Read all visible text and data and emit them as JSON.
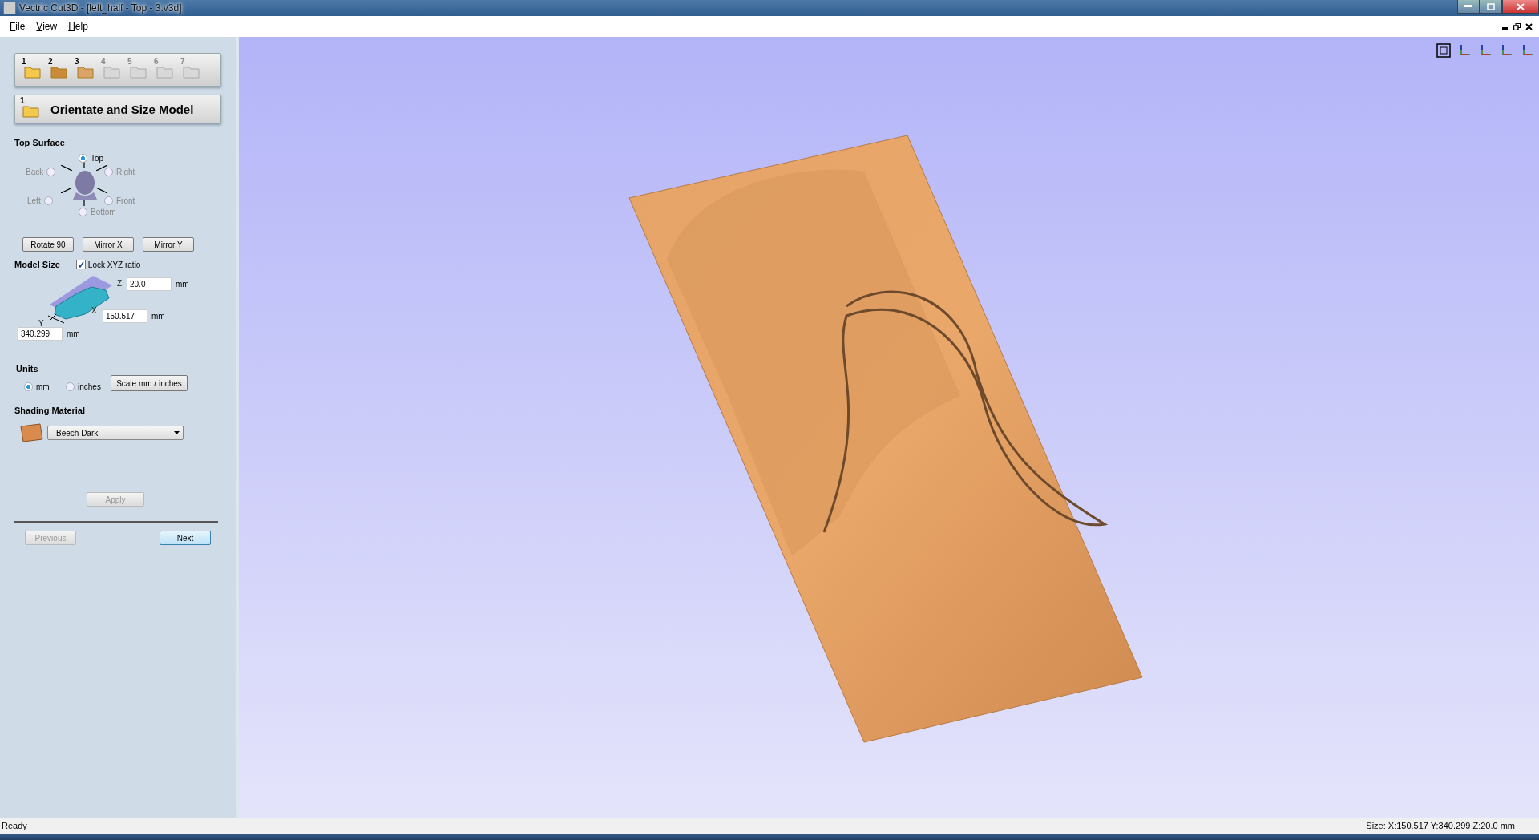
{
  "window": {
    "title": "Vectric Cut3D - [left_half - Top - 3.v3d]"
  },
  "menu": [
    {
      "label": "File"
    },
    {
      "label": "View"
    },
    {
      "label": "Help"
    }
  ],
  "wizard_steps": [
    {
      "label": "1",
      "enabled": true
    },
    {
      "label": "2",
      "enabled": true
    },
    {
      "label": "3",
      "enabled": true
    },
    {
      "label": "4",
      "enabled": false
    },
    {
      "label": "5",
      "enabled": false
    },
    {
      "label": "6",
      "enabled": false
    },
    {
      "label": "7",
      "enabled": false
    }
  ],
  "heading": {
    "step": "1",
    "title": "Orientate and Size Model"
  },
  "top_surface": {
    "label": "Top Surface",
    "options": [
      {
        "label": "Top",
        "selected": true
      },
      {
        "label": "Back",
        "selected": false
      },
      {
        "label": "Right",
        "selected": false
      },
      {
        "label": "Left",
        "selected": false
      },
      {
        "label": "Front",
        "selected": false
      },
      {
        "label": "Bottom",
        "selected": false
      }
    ],
    "buttons": [
      {
        "label": "Rotate 90"
      },
      {
        "label": "Mirror X"
      },
      {
        "label": "Mirror Y"
      }
    ]
  },
  "model_size": {
    "label": "Model Size",
    "lock": {
      "label": "Lock XYZ ratio",
      "checked": true
    },
    "axes": [
      "Z",
      "X",
      "Y"
    ],
    "fields": [
      {
        "value": "20.0",
        "unit": "mm"
      },
      {
        "value": "150.517",
        "unit": "mm"
      },
      {
        "value": "340.299",
        "unit": "mm"
      }
    ]
  },
  "units": {
    "label": "Units",
    "options": [
      {
        "label": "mm",
        "selected": true
      },
      {
        "label": "inches",
        "selected": false
      }
    ],
    "scale_button": "Scale mm / inches"
  },
  "shading": {
    "label": "Shading Material",
    "material": "Beech Dark"
  },
  "apply": {
    "label": "Apply",
    "disabled": true
  },
  "nav": [
    {
      "label": "Previous",
      "disabled": true
    },
    {
      "label": "Next",
      "disabled": false
    }
  ],
  "status_bar": {
    "left": "Ready",
    "right": "Size: X:150.517 Y:340.299 Z:20.0 mm"
  }
}
